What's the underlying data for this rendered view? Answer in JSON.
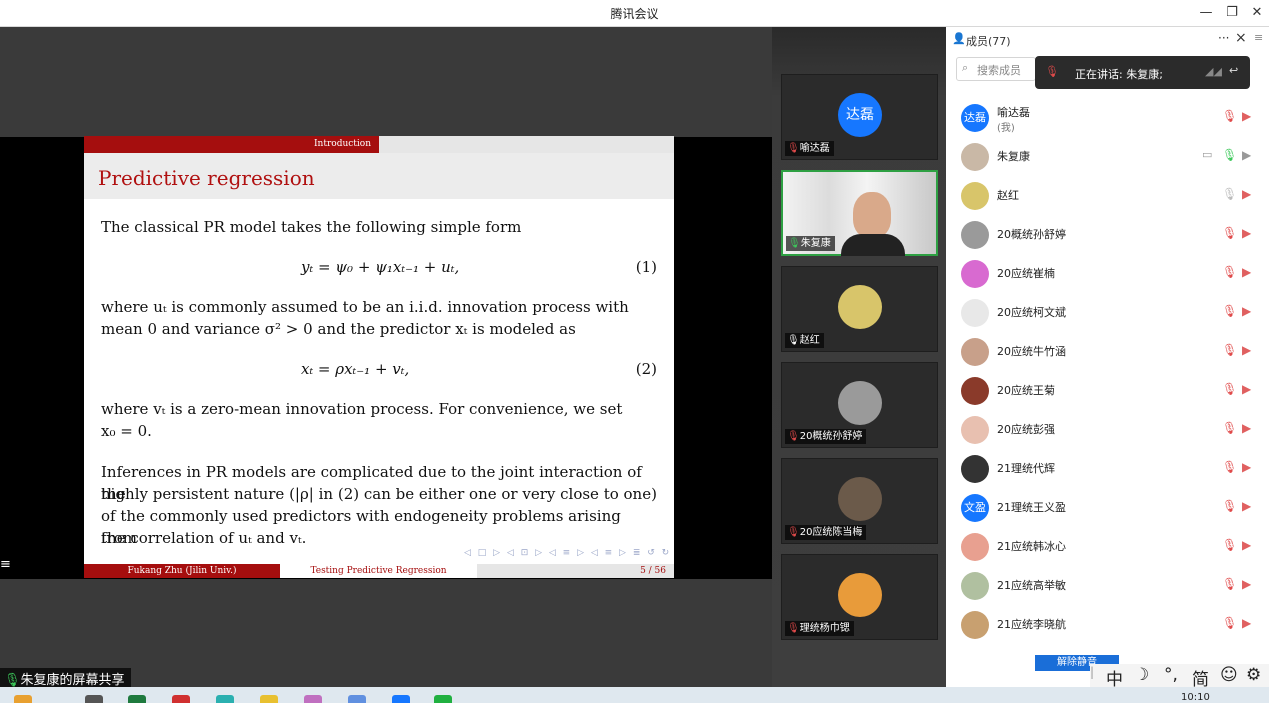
{
  "window": {
    "title": "腾讯会议"
  },
  "slide": {
    "section": "Introduction",
    "title": "Predictive regression",
    "p1": "The classical PR model takes the following simple form",
    "eq1": "yₜ = ψ₀ + ψ₁xₜ₋₁ + uₜ,",
    "eq1_num": "(1)",
    "p2_line1": "where uₜ is commonly assumed to be an i.i.d. innovation process with",
    "p2_line2": "mean 0 and variance σ² > 0 and the predictor xₜ is modeled as",
    "eq2": "xₜ = ρxₜ₋₁ + vₜ,",
    "eq2_num": "(2)",
    "p3_line1": "where vₜ is a zero-mean innovation process. For convenience, we set",
    "p3_line2": "x₀ = 0.",
    "p4_line1": "Inferences in PR models are complicated due to the joint interaction of the",
    "p4_line2": "highly persistent nature (|ρ| in (2) can be either one or very close to one)",
    "p4_line3": "of the commonly used predictors with endogeneity problems arising from",
    "p4_line4": "the correlation of uₜ and vₜ.",
    "nav": "◁ □ ▷ ◁ ⊡ ▷ ◁ ≡ ▷ ◁ ≡ ▷ ≣ ↺ ↻",
    "footer_author": "Fukang Zhu (Jilin Univ.)",
    "footer_title": "Testing Predictive Regression",
    "footer_page": "5 / 56"
  },
  "share_label": "朱复康的屏幕共享",
  "menu_icon": "≡",
  "video_tiles": [
    {
      "name": "喻达磊",
      "avatar_text": "达磊",
      "avatar_color": "#1677ff",
      "mic": "muted"
    },
    {
      "name": "朱复康",
      "camera": true,
      "mic": "on"
    },
    {
      "name": "赵红",
      "avatar_color": "#d8c56a",
      "mic": "on"
    },
    {
      "name": "20概统孙舒婷",
      "avatar_color": "#9a9a9a",
      "mic": "muted"
    },
    {
      "name": "20应统陈当梅",
      "avatar_color": "#6b5a4a",
      "mic": "muted"
    },
    {
      "name": "理统杨巾锶",
      "avatar_color": "#e89b3a",
      "mic": "muted"
    }
  ],
  "panel": {
    "title": "成员(77)",
    "more": "···",
    "close": "×",
    "search_placeholder": "搜索成员",
    "speaking_label": "正在讲话: 朱复康;",
    "members": [
      {
        "name": "喻达磊",
        "sub": "(我)",
        "avatar_text": "达磊",
        "avatar_color": "#1677ff",
        "mic": "muted"
      },
      {
        "name": "朱复康",
        "avatar_color": "#c9b8a6",
        "mic": "on"
      },
      {
        "name": "赵红",
        "avatar_color": "#d8c56a",
        "mic": "gray"
      },
      {
        "name": "20概统孙舒婷",
        "avatar_color": "#9a9a9a",
        "mic": "muted"
      },
      {
        "name": "20应统崔楠",
        "avatar_color": "#d86ad0",
        "mic": "muted"
      },
      {
        "name": "20应统柯文斌",
        "avatar_color": "#e8e8e8",
        "mic": "muted"
      },
      {
        "name": "20应统牛竹涵",
        "avatar_color": "#c8a08a",
        "mic": "muted"
      },
      {
        "name": "20应统王菊",
        "avatar_color": "#8a3a2a",
        "mic": "muted"
      },
      {
        "name": "20应统彭强",
        "avatar_color": "#e8c0b0",
        "mic": "muted"
      },
      {
        "name": "21理统代辉",
        "avatar_color": "#333333",
        "mic": "muted"
      },
      {
        "name": "21理统王义盈",
        "avatar_text": "文盈",
        "avatar_color": "#1677ff",
        "mic": "muted"
      },
      {
        "name": "21应统韩冰心",
        "avatar_color": "#e8a090",
        "mic": "muted"
      },
      {
        "name": "21应统高举敏",
        "avatar_color": "#b0c0a0",
        "mic": "muted"
      },
      {
        "name": "21应统李晓航",
        "avatar_color": "#c8a070",
        "mic": "muted"
      }
    ],
    "unmute_button": "解除静音",
    "ime": {
      "zh": "中",
      "moon": "☽",
      "punct": "°,",
      "simp": "简",
      "gear": "⚙"
    }
  },
  "taskbar": {
    "clock": "10:10"
  },
  "colors": {
    "accent_red": "#a50e0e",
    "active_green": "#2ea043",
    "brand_blue": "#1677ff"
  }
}
